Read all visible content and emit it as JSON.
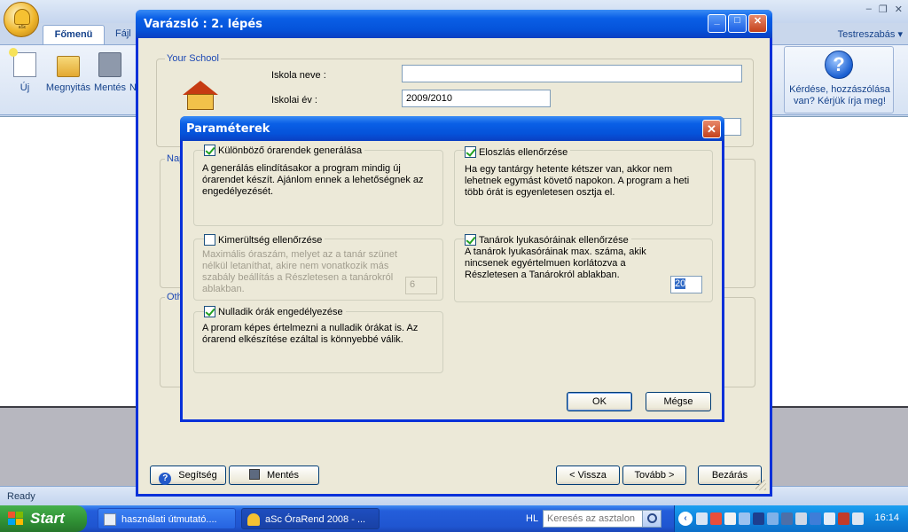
{
  "app": {
    "tabs": {
      "main": "Főmenü",
      "file": "Fájl",
      "customize": "Testreszabás"
    },
    "ribbon": {
      "new": "Új",
      "open": "Megnyitás",
      "save": "Mentés",
      "cut_label": "N"
    },
    "help_text": "Kérdése, hozzászólása van? Kérjük írja meg!",
    "status": "Ready"
  },
  "wizard": {
    "title": "Varázsló : 2. lépés",
    "school_group": "Your School",
    "school_name_label": "Iskola neve :",
    "school_name_value": "",
    "school_year_label": "Iskolai év :",
    "school_year_value": "2009/2010",
    "days_group": "Nap",
    "other_group": "Oth",
    "buttons": {
      "help": "Segítség",
      "save": "Mentés",
      "back": "< Vissza",
      "next": "Tovább >",
      "close": "Bezárás"
    }
  },
  "dialog": {
    "title": "Paraméterek",
    "groups": {
      "diff_timetables": {
        "label": "Különböző órarendek generálása",
        "checked": true,
        "desc1": "A generálás elindításakor a program mindig új",
        "desc2": "órarendet készít. Ajánlom ennek a lehetőségnek az",
        "desc3": "engedélyezését."
      },
      "distribution": {
        "label": "Eloszlás ellenőrzése",
        "checked": true,
        "desc1": "Ha egy tantárgy hetente kétszer van, akkor nem",
        "desc2": "lehetnek egymást követő napokon. A program a heti",
        "desc3": "több órát is egyenletesen osztja el."
      },
      "fatigue": {
        "label": "Kimerültség ellenőrzése",
        "checked": false,
        "desc1": "Maximális óraszám, melyet az a tanár szünet",
        "desc2": "nélkül letaníthat, akire nem vonatkozik más",
        "desc3": "szabály beállítás a Részletesen a tanárokról",
        "desc4": "ablakban.",
        "value": "6"
      },
      "gaps": {
        "label": "Tanárok lyukasóráinak ellenőrzése",
        "checked": true,
        "desc1": "A tanárok lyukasóráinak max. száma, akik",
        "desc2": "nincsenek egyértelmuen korlátozva a",
        "desc3": "Részletesen a Tanárokról ablakban.",
        "value": "20"
      },
      "zero_lessons": {
        "label": "Nulladik órák engedélyezése",
        "checked": true,
        "desc1": "A proram képes értelmezni a nulladik órákat is. Az",
        "desc2": "órarend elkészítése ezáltal is könnyebbé válik."
      }
    },
    "ok": "OK",
    "cancel": "Mégse"
  },
  "taskbar": {
    "start": "Start",
    "tasks": [
      "használati útmutató....",
      "aSc ÓraRend 2008 - ..."
    ],
    "lang": "HL",
    "search_placeholder": "Keresés az asztalon",
    "clock": "16:14"
  },
  "colors": {
    "xp_title_blue": "#0553da",
    "dialog_face": "#ece9d8",
    "groupbox_label_blue": "#1b47b3",
    "taskbar_blue": "#245edb",
    "start_green": "#2f8f34"
  }
}
